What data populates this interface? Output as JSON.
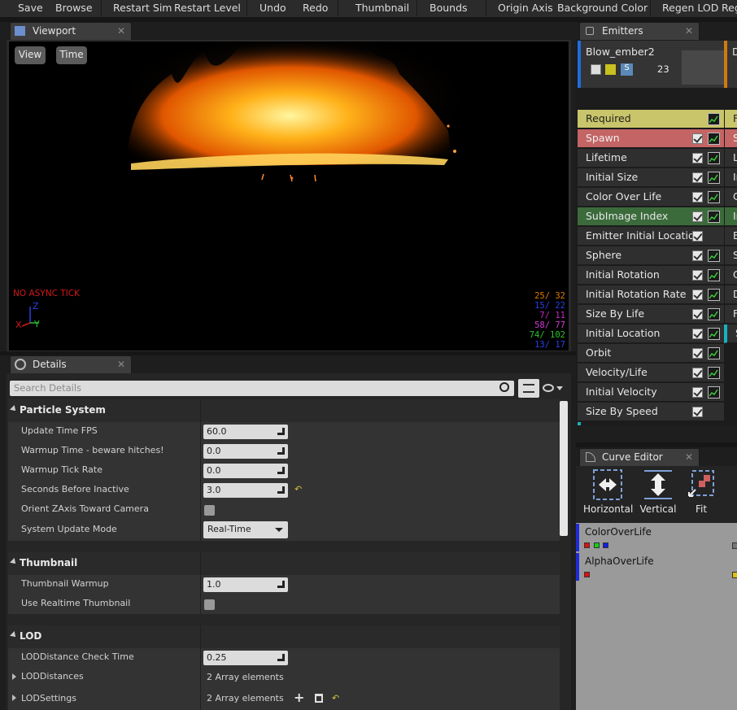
{
  "toolbar": {
    "items": [
      "Save",
      "Browse",
      "Restart Sim",
      "Restart Level",
      "Undo",
      "Redo",
      "Thumbnail",
      "Bounds",
      "Origin Axis",
      "Background Color",
      "Regen LOD",
      "Regen"
    ]
  },
  "viewport": {
    "tab_title": "Viewport",
    "view_button": "View",
    "time_button": "Time",
    "status_text": "NO ASYNC TICK",
    "axis": {
      "z": "Z",
      "x": "X",
      "y": "Y"
    },
    "stats": [
      "25/ 32",
      "15/ 22",
      "7/ 11",
      "58/ 77",
      "74/ 102",
      "13/ 17"
    ],
    "stat_colors": [
      "#e07b00",
      "#2b3fe6",
      "#c229c2",
      "#d23ad2",
      "#2cc12c",
      "#2b3fe6"
    ]
  },
  "emitters": {
    "tab_title": "Emitters",
    "emitter_name": "Blow_ember2",
    "emitter_count": "23",
    "emitter2_initial": "D",
    "modules": [
      {
        "label": "Required",
        "color": "#c9c56a",
        "text_color": "#222",
        "check": false,
        "curve": true
      },
      {
        "label": "Spawn",
        "color": "#c46464",
        "text_color": "#f0f0f0",
        "check": true,
        "curve": true
      },
      {
        "label": "Lifetime",
        "color": "#2f2f2f",
        "check": true,
        "curve": true
      },
      {
        "label": "Initial Size",
        "color": "#2f2f2f",
        "check": true,
        "curve": true
      },
      {
        "label": "Color Over Life",
        "color": "#2f2f2f",
        "check": true,
        "curve": true
      },
      {
        "label": "SubImage Index",
        "color": "#3b6b3b",
        "check": true,
        "curve": true
      },
      {
        "label": "Emitter Initial Location",
        "color": "#2f2f2f",
        "check": true,
        "curve": false
      },
      {
        "label": "Sphere",
        "color": "#2f2f2f",
        "check": true,
        "curve": true
      },
      {
        "label": "Initial Rotation",
        "color": "#2f2f2f",
        "check": true,
        "curve": true
      },
      {
        "label": "Initial Rotation Rate",
        "color": "#2f2f2f",
        "check": true,
        "curve": true
      },
      {
        "label": "Size By Life",
        "color": "#2f2f2f",
        "check": true,
        "curve": true
      },
      {
        "label": "Initial Location",
        "color": "#2f2f2f",
        "check": true,
        "curve": true
      },
      {
        "label": "Orbit",
        "color": "#2f2f2f",
        "check": true,
        "curve": true
      },
      {
        "label": "Velocity/Life",
        "color": "#2f2f2f",
        "check": true,
        "curve": true
      },
      {
        "label": "Initial Velocity",
        "color": "#2f2f2f",
        "check": true,
        "curve": true
      },
      {
        "label": "Size By Speed",
        "color": "#2f2f2f",
        "check": true,
        "curve": false
      }
    ],
    "col2": [
      "F",
      "S",
      "L",
      "Ir",
      "C",
      "Ir",
      "E",
      "S",
      "C",
      "D",
      "F",
      "S"
    ]
  },
  "details": {
    "tab_title": "Details",
    "search_placeholder": "Search Details",
    "particle_system": {
      "title": "Particle System",
      "update_fps_label": "Update Time FPS",
      "update_fps": "60.0",
      "warmup_label": "Warmup Time - beware hitches!",
      "warmup": "0.0",
      "warmup_tick_label": "Warmup Tick Rate",
      "warmup_tick": "0.0",
      "seconds_label": "Seconds Before Inactive",
      "seconds": "3.0",
      "orient_label": "Orient ZAxis Toward Camera",
      "update_mode_label": "System Update Mode",
      "update_mode": "Real-Time"
    },
    "thumbnail": {
      "title": "Thumbnail",
      "warmup_label": "Thumbnail Warmup",
      "warmup": "1.0",
      "realtime_label": "Use Realtime Thumbnail"
    },
    "lod": {
      "title": "LOD",
      "check_time_label": "LODDistance Check Time",
      "check_time": "0.25",
      "distances_label": "LODDistances",
      "distances": "2 Array elements",
      "settings_label": "LODSettings",
      "settings": "2 Array elements"
    }
  },
  "curve_editor": {
    "tab_title": "Curve Editor",
    "horizontal": "Horizontal",
    "vertical": "Vertical",
    "fit": "Fit",
    "curves": [
      {
        "name": "ColorOverLife",
        "swatches": [
          "#e01010",
          "#10d010",
          "#1020e0"
        ],
        "end_color": "#777"
      },
      {
        "name": "AlphaOverLife",
        "swatches": [
          "#e01010"
        ],
        "end_color": "#e0c010"
      }
    ]
  }
}
